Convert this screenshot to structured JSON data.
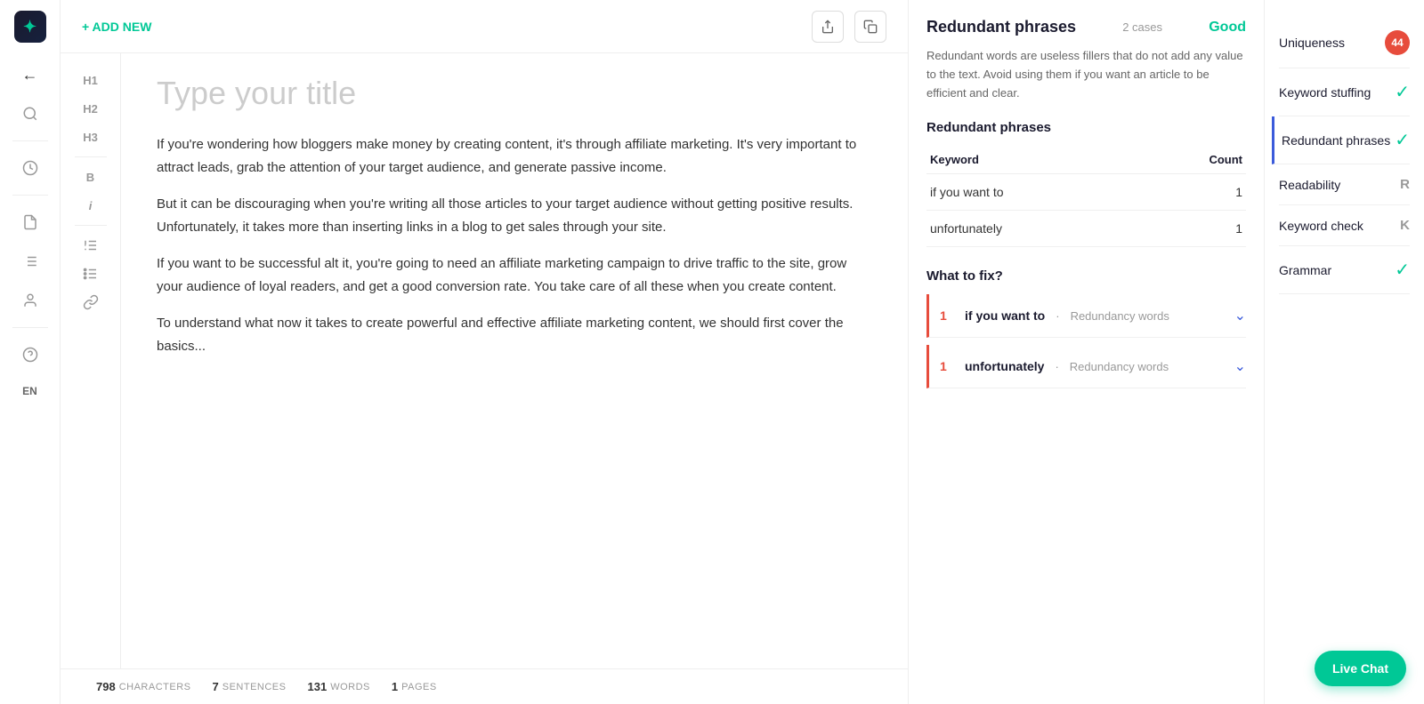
{
  "sidebar": {
    "logo": "✦",
    "lang": "EN"
  },
  "toolbar": {
    "add_new": "+ ADD NEW",
    "share_icon": "↗",
    "copy_icon": "⧉"
  },
  "format": {
    "headings": [
      "H1",
      "H2",
      "H3",
      "B",
      "i"
    ],
    "icons": [
      "☰",
      "≡",
      "⌘"
    ]
  },
  "editor": {
    "title": "Type your title",
    "paragraphs": [
      "If you're wondering how bloggers make money by creating content, it's through affiliate marketing. It's very important to attract leads, grab the attention of your target audience, and generate passive income.",
      "But it can be discouraging when you're writing all those articles to your target audience without getting positive results. Unfortunately, it takes more than inserting links in a blog to get sales through your site.",
      "If you want to be successful alt it, you're going to need an affiliate marketing campaign to drive traffic to the site, grow your audience of loyal readers, and get a good conversion rate. You take care of all these when you create content.",
      "To understand what now it takes to create powerful and effective affiliate marketing content, we should first cover the basics..."
    ]
  },
  "footer": {
    "characters": {
      "num": "798",
      "label": "CHARACTERS"
    },
    "sentences": {
      "num": "7",
      "label": "SENTENCES"
    },
    "words": {
      "num": "131",
      "label": "WORDS"
    },
    "pages": {
      "num": "1",
      "label": "PAGES"
    }
  },
  "right_panel": {
    "title": "Redundant phrases",
    "cases": "2 cases",
    "status": "Good",
    "description": "Redundant words are useless fillers that do not add any value to the text. Avoid using them if you want an article to be efficient and clear.",
    "subtitle": "Redundant phrases",
    "table": {
      "col1": "Keyword",
      "col2": "Count",
      "rows": [
        {
          "keyword": "if you want to",
          "count": "1"
        },
        {
          "keyword": "unfortunately",
          "count": "1"
        }
      ]
    },
    "what_fix": "What to fix?",
    "fix_items": [
      {
        "num": "1",
        "keyword": "if you want to",
        "separator": "·",
        "type": "Redundancy words"
      },
      {
        "num": "1",
        "keyword": "unfortunately",
        "separator": "·",
        "type": "Redundancy words"
      }
    ]
  },
  "right_nav": {
    "items": [
      {
        "label": "Uniqueness",
        "badge": "44",
        "type": "red"
      },
      {
        "label": "Keyword stuffing",
        "type": "check"
      },
      {
        "label": "Redundant phrases",
        "type": "check",
        "active": true
      },
      {
        "label": "Readability",
        "badge": "R",
        "type": "letter"
      },
      {
        "label": "Keyword check",
        "badge": "K",
        "type": "letter"
      },
      {
        "label": "Grammar",
        "type": "check"
      }
    ]
  },
  "live_chat": "Live Chat"
}
